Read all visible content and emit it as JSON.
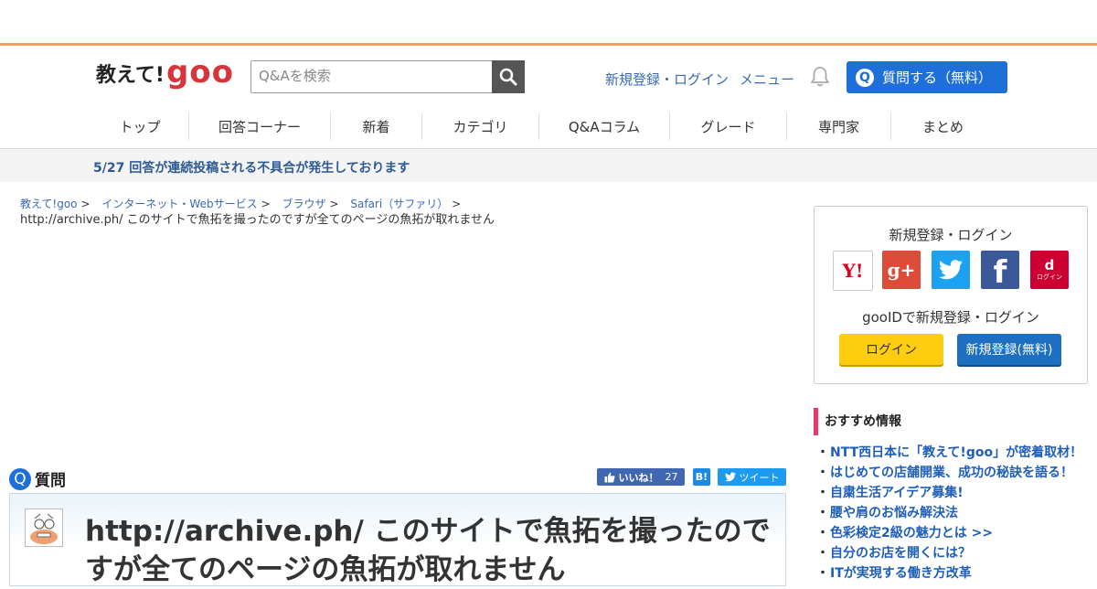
{
  "header": {
    "logo_text": "教えて!",
    "logo_goo": "goo",
    "search_placeholder": "Q&Aを検索",
    "signup_login": "新規登録・ログイン",
    "menu": "メニュー",
    "ask_q": "Q",
    "ask_label": "質問する（無料）",
    "accent_color": "#f5a05a"
  },
  "nav": [
    "トップ",
    "回答コーナー",
    "新着",
    "カテゴリ",
    "Q&Aコラム",
    "グレード",
    "専門家",
    "まとめ"
  ],
  "notice": "5/27 回答が連続投稿される不具合が発生しております",
  "breadcrumb": [
    "教えて!goo",
    "インターネット・Webサービス",
    "ブラウザ",
    "Safari（サファリ）"
  ],
  "breadcrumb_current": "http://archive.ph/ このサイトで魚拓を撮ったのですが全てのページの魚拓が取れません",
  "question": {
    "icon_letter": "Q",
    "label": "質問",
    "title": "http://archive.ph/ このサイトで魚拓を撮ったのですが全てのページの魚拓が取れません"
  },
  "share": {
    "like_label": "いいね！",
    "like_count": "27",
    "hatena_label": "B!",
    "tweet_label": "ツイート"
  },
  "sidebar": {
    "login_title": "新規登録・ログイン",
    "social": [
      {
        "name": "yahoo",
        "label": "Y!"
      },
      {
        "name": "google-plus",
        "label": "g+"
      },
      {
        "name": "twitter",
        "label": ""
      },
      {
        "name": "facebook",
        "label": "f"
      },
      {
        "name": "docomo",
        "label": "d",
        "sub": "ログイン"
      }
    ],
    "gooid": "gooIDで新規登録・ログイン",
    "login_button": "ログイン",
    "register_button": "新規登録(無料)",
    "recommend_title": "おすすめ情報",
    "recommend_items": [
      "NTT西日本に「教えて!goo」が密着取材！",
      "はじめての店舗開業、成功の秘訣を語る！",
      "自粛生活アイデア募集!",
      "腰や肩のお悩み解決法",
      "色彩検定2級の魅力とは >>",
      "自分のお店を開くには？",
      "ITが実現する働き方改革"
    ]
  }
}
